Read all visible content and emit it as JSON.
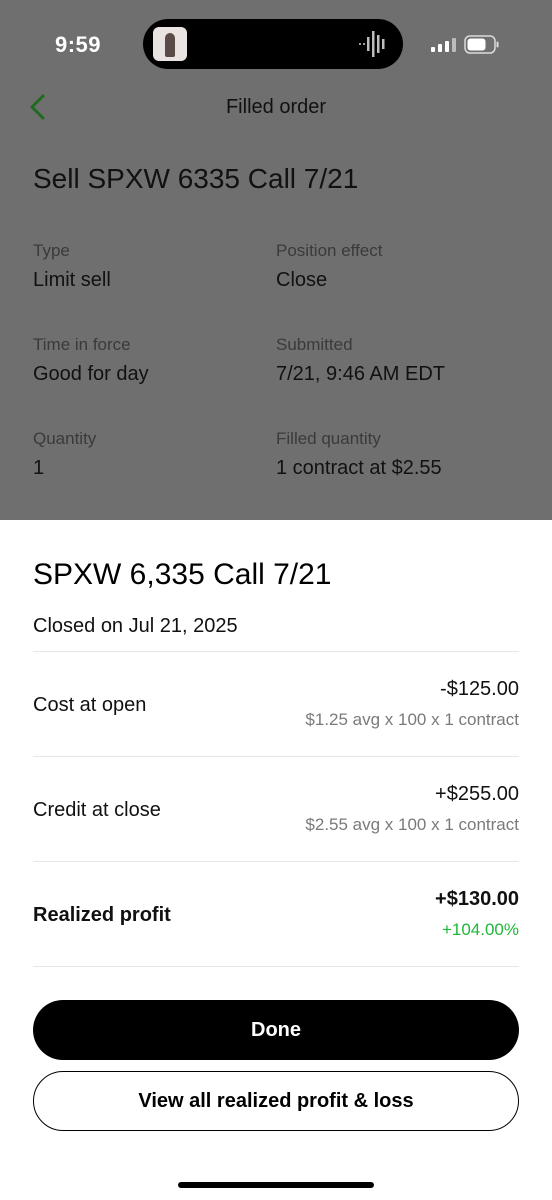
{
  "status_bar": {
    "time": "9:59"
  },
  "header": {
    "title": "Filled order"
  },
  "order": {
    "title": "Sell SPXW 6335 Call 7/21",
    "details": [
      {
        "label": "Type",
        "value": "Limit sell"
      },
      {
        "label": "Position effect",
        "value": "Close"
      },
      {
        "label": "Time in force",
        "value": "Good for day"
      },
      {
        "label": "Submitted",
        "value": "7/21, 9:46 AM EDT"
      },
      {
        "label": "Quantity",
        "value": "1"
      },
      {
        "label": "Filled quantity",
        "value": "1 contract at $2.55"
      }
    ]
  },
  "sheet": {
    "title": "SPXW 6,335 Call 7/21",
    "subtitle": "Closed on Jul 21, 2025",
    "rows": [
      {
        "label": "Cost at open",
        "amount": "-$125.00",
        "detail": "$1.25 avg x 100 x 1 contract"
      },
      {
        "label": "Credit at close",
        "amount": "+$255.00",
        "detail": "$2.55 avg x 100 x 1 contract"
      },
      {
        "label": "Realized profit",
        "amount": "+$130.00",
        "detail": "+104.00%"
      }
    ],
    "done_label": "Done",
    "view_all_label": "View all realized profit & loss"
  },
  "colors": {
    "accent_green": "#1fb73a",
    "back_arrow": "#1f6a1f",
    "overlay": "#6f6f6f"
  },
  "icons": {
    "back": "chevron-left-icon",
    "signal": "cellular-signal-icon",
    "battery": "battery-icon",
    "audio": "audio-waveform-icon"
  }
}
